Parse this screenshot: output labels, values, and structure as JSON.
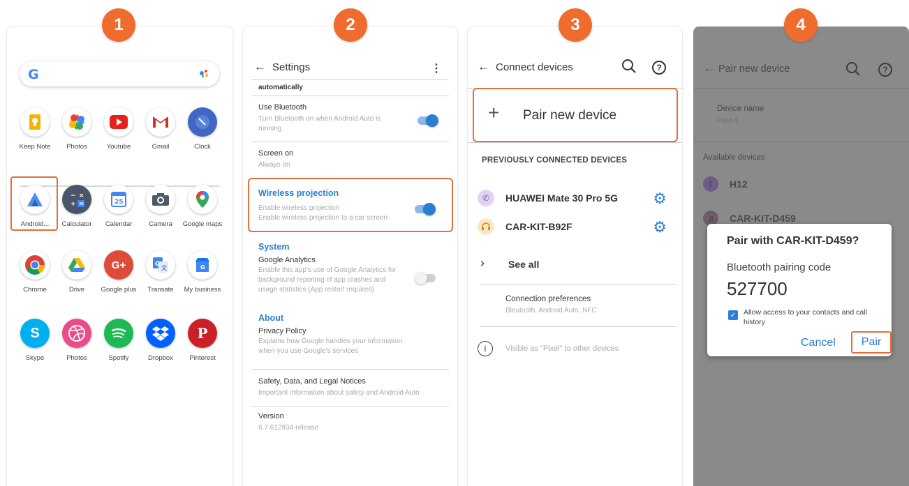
{
  "steps": [
    "1",
    "2",
    "3",
    "4"
  ],
  "launcher": {
    "search_logo": "G",
    "dock": [
      {
        "label": "Keep Note",
        "icon": "keep-note-icon"
      },
      {
        "label": "Photos",
        "icon": "photos-icon"
      },
      {
        "label": "Youtube",
        "icon": "youtube-icon"
      },
      {
        "label": "Gmail",
        "icon": "gmail-icon"
      },
      {
        "label": "Clock",
        "icon": "clock-icon"
      }
    ],
    "apps": [
      {
        "label": "Android...",
        "icon": "android-auto-icon"
      },
      {
        "label": "Calculator",
        "icon": "calculator-icon"
      },
      {
        "label": "Calendar",
        "icon": "calendar-icon",
        "glyph": "25"
      },
      {
        "label": "Camera",
        "icon": "camera-icon"
      },
      {
        "label": "Google maps",
        "icon": "google-maps-icon"
      },
      {
        "label": "Chrome",
        "icon": "chrome-icon"
      },
      {
        "label": "Drive",
        "icon": "drive-icon"
      },
      {
        "label": "Google plus",
        "icon": "google-plus-icon",
        "glyph": "G+"
      },
      {
        "label": "Transate",
        "icon": "translate-icon"
      },
      {
        "label": "My business",
        "icon": "my-business-icon"
      },
      {
        "label": "Skype",
        "icon": "skype-icon",
        "glyph": "S"
      },
      {
        "label": "Photos",
        "icon": "dribbble-photos-icon"
      },
      {
        "label": "Spotify",
        "icon": "spotify-icon"
      },
      {
        "label": "Dropbox",
        "icon": "dropbox-icon"
      },
      {
        "label": "Pinterest",
        "icon": "pinterest-icon",
        "glyph": "P"
      }
    ]
  },
  "settings": {
    "title": "Settings",
    "truncated_top": "automatically",
    "use_bluetooth": {
      "title": "Use Bluetooth",
      "sub": "Turn Bluetooth on when Android Auto is running",
      "on": true
    },
    "screen_on": {
      "title": "Screen on",
      "sub": "Always on"
    },
    "wireless": {
      "title": "Wireless projection",
      "sub1": "Enable wireless projection",
      "sub2": "Enable wireless projection to a car screen",
      "on": true
    },
    "system": {
      "heading": "System",
      "title": "Google Analytics",
      "sub": "Enable this app's use of Google Analytics for background reporting of app crashes and usage statistics (App restart required)",
      "on": false
    },
    "about": {
      "heading": "About",
      "title": "Privacy Policy",
      "sub": "Explains how Google handles your information when you use Google's services"
    },
    "safety": {
      "title": "Safety, Data, and Legal Notices",
      "sub": "Important information about safety and Android Auto"
    },
    "version": {
      "title": "Version",
      "sub": "6.7.612934-release"
    }
  },
  "connect": {
    "title": "Connect devices",
    "pair_new": "Pair new device",
    "previously": "PREVIOUSLY CONNECTED DEVICES",
    "devices": [
      {
        "name": "HUAWEI Mate 30 Pro 5G",
        "icon": "phone-icon"
      },
      {
        "name": "CAR-KIT-B92F",
        "icon": "headset-icon"
      }
    ],
    "see_all": "See all",
    "prefs_title": "Connection preferences",
    "prefs_sub": "Bleutooth, Android Auto, NFC",
    "visible": "Visible as \"Pixel\" to other devices"
  },
  "pairing": {
    "title": "Pair new device",
    "device_name_label": "Device name",
    "device_name_value": "Pixel 4",
    "available": "Available devices",
    "devices": [
      "H12",
      "CAR-KIT-D459"
    ],
    "dialog": {
      "title": "Pair with CAR-KIT-D459?",
      "code_label": "Bluetooth pairing code",
      "code": "527700",
      "allow": "Allow access to your contacts and call history",
      "cancel": "Cancel",
      "pair": "Pair"
    }
  },
  "colors": {
    "badge": "#ef6c2e",
    "highlight": "#e36f3b",
    "accent": "#2a7fd4",
    "overlay": "#8a8a8a"
  }
}
